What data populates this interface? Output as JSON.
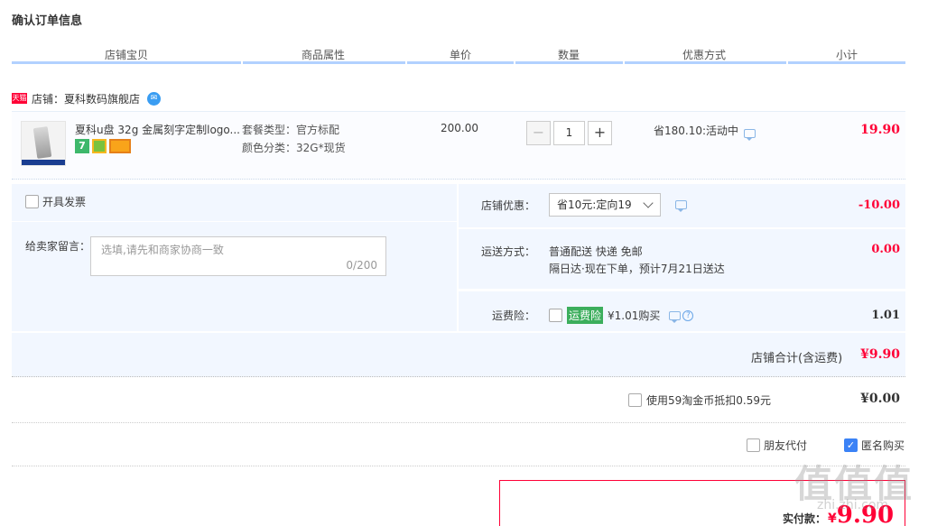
{
  "page_title": "确认订单信息",
  "columns": [
    "店铺宝贝",
    "商品属性",
    "单价",
    "数量",
    "优惠方式",
    "小计"
  ],
  "shop": {
    "badge": "天猫",
    "name": "店铺：夏科数码旗舰店"
  },
  "item": {
    "name": "夏科u盘 32g 金属刻字定制logo...",
    "badge_7": "7",
    "sku_package": "套餐类型：官方标配",
    "sku_color": "颜色分类：32G*现货",
    "price": "200.00",
    "qty": "1",
    "minus": "−",
    "plus": "+",
    "promo": "省180.10:活动中",
    "subtotal": "19.90"
  },
  "invoice": {
    "label": "开具发票"
  },
  "message": {
    "label": "给卖家留言：",
    "placeholder": "选填,请先和商家协商一致",
    "count": "0/200"
  },
  "shop_discount": {
    "label": "店铺优惠：",
    "selected": "省10元:定向19",
    "value": "-10.00"
  },
  "shipping": {
    "label": "运送方式：",
    "line1": "普通配送 快递 免邮",
    "line2": "隔日达·现在下单，预计7月21日送达",
    "value": "0.00"
  },
  "insurance": {
    "label": "运费险：",
    "tag": "运费险",
    "text": "¥1.01购买",
    "help": "?",
    "value": "1.01"
  },
  "shop_total": {
    "label": "店铺合计(含运费)",
    "value": "¥9.90"
  },
  "coins": {
    "label": "使用59淘金币抵扣0.59元",
    "value": "¥0.00"
  },
  "friend_pay": {
    "label": "朋友代付"
  },
  "anonymous": {
    "label": "匿名购买",
    "check": "✓"
  },
  "actual_pay": {
    "label": "实付款：",
    "currency": "¥",
    "value": "9.90"
  },
  "watermark": {
    "main": "值值值",
    "sub": "zhi.zhi.com"
  }
}
